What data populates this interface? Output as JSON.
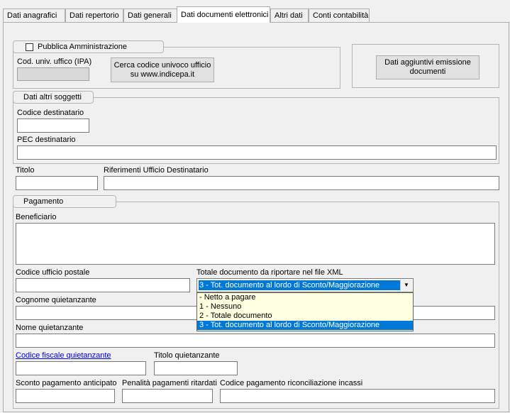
{
  "tabs": [
    {
      "label": "Dati anagrafici"
    },
    {
      "label": "Dati repertorio"
    },
    {
      "label": "Dati generali"
    },
    {
      "label": "Dati documenti elettronici"
    },
    {
      "label": "Altri dati"
    },
    {
      "label": "Conti contabilità"
    }
  ],
  "pa": {
    "checkbox_label": "Pubblica Amministrazione",
    "checked": false,
    "cod_label": "Cod. univ. uffico (IPA)",
    "cod_value": "",
    "search_button": "Cerca codice univoco ufficio su www.indicepa.it",
    "extra_button": "Dati aggiuntivi emissione documenti"
  },
  "altri_soggetti": {
    "legend": "Dati altri soggetti",
    "codice_label": "Codice destinatario",
    "codice_value": "",
    "pec_label": "PEC destinatario",
    "pec_value": ""
  },
  "titolo_label": "Titolo",
  "titolo_value": "",
  "rif_label": "Riferimenti Ufficio Destinatario",
  "rif_value": "",
  "pagamento": {
    "legend": "Pagamento",
    "beneficiario_label": "Beneficiario",
    "beneficiario_value": "",
    "ufficio_postale_label": "Codice ufficio postale",
    "ufficio_postale_value": "",
    "totale_label": "Totale documento da riportare nel file XML",
    "totale_selected": "3 - Tot. documento al lordo di Sconto/Maggiorazione",
    "totale_options": [
      " - Netto a pagare",
      "1 - Nessuno",
      "2 - Totale documento",
      "3 - Tot. documento al lordo di Sconto/Maggiorazione"
    ],
    "cognome_label": "Cognome quietanzante",
    "cognome_value": "",
    "nome_label": "Nome quietanzante",
    "nome_value": "",
    "cf_label": "Codice fiscale quietanzante",
    "cf_value": "",
    "titolo_q_label": "Titolo quietanzante",
    "titolo_q_value": "",
    "sconto_label": "Sconto pagamento anticipato",
    "sconto_value": "",
    "penalita_label": "Penalità pagamenti ritardati",
    "penalita_value": "",
    "riconciliazione_label": "Codice pagamento riconciliazione incassi",
    "riconciliazione_value": ""
  },
  "colors": {
    "selection": "#0078d7",
    "dropdown_bg": "#ffffe1",
    "link": "#0000ee"
  }
}
